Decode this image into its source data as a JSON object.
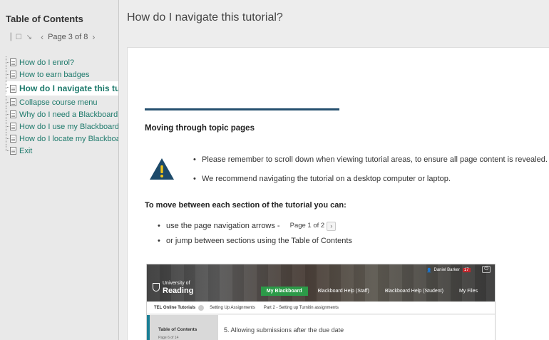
{
  "sidebar": {
    "title": "Table of Contents",
    "pager": {
      "text": "Page 3 of 8",
      "prev": "‹",
      "next": "›"
    },
    "items": [
      {
        "label": "How do I enrol?"
      },
      {
        "label": "How to earn badges"
      },
      {
        "label": "How do I navigate this tutorial?",
        "active": true
      },
      {
        "label": "Collapse course menu"
      },
      {
        "label": "Why do I need a Blackboard..."
      },
      {
        "label": "How do I use my Blackboard..."
      },
      {
        "label": "How do I locate my Blackboard..."
      },
      {
        "label": "Exit"
      }
    ]
  },
  "main": {
    "title": "How do I navigate this tutorial?",
    "heading1": "Moving through topic pages",
    "bullets": [
      "Please remember to scroll down when viewing tutorial areas, to ensure all page content is revealed.",
      "We recommend navigating the tutorial on a desktop computer or laptop."
    ],
    "heading2": "To move between each section of the tutorial you can:",
    "nav_bullets": {
      "arrows": "use the page navigation arrows -",
      "mini_pager": "Page 1 of 2",
      "toc": "or jump between sections using the Table of Contents"
    }
  },
  "screenshot": {
    "logo_small": "University of",
    "logo_big": "Reading",
    "user": "Daniel Barker",
    "badge": "17",
    "nav": [
      "My Blackboard",
      "Blackboard Help (Staff)",
      "Blackboard Help (Student)",
      "My Files"
    ],
    "crumbs": [
      "TEL Online Tutorials",
      "Setting Up Assignments",
      "Part 2 - Setting up Turnitin assignments"
    ],
    "toc_title": "Table of Contents",
    "toc_pager": "Page 6 of 14",
    "step": "5. Allowing submissions after the due date"
  },
  "colors": {
    "link": "#1e7a6c",
    "rule": "#25506f",
    "warning": "#1d4a6a",
    "nav_highlight": "#2c9a48"
  }
}
